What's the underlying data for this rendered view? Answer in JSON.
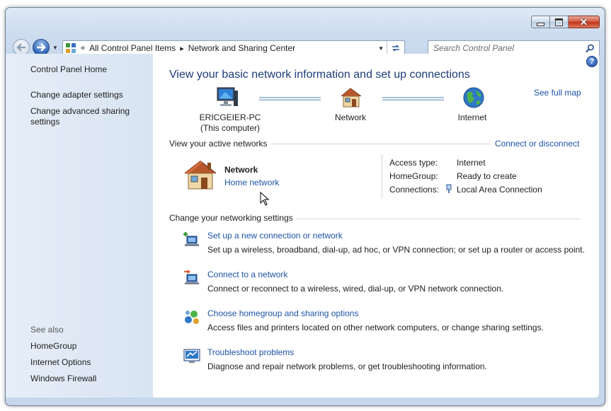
{
  "address_bar": {
    "prefix": "«",
    "crumbs": [
      "All Control Panel Items",
      "Network and Sharing Center"
    ],
    "separator": "▸"
  },
  "search": {
    "placeholder": "Search Control Panel"
  },
  "caption_buttons": {
    "minimize": "–",
    "maximize": "□",
    "close": "✕"
  },
  "sidebar": {
    "home": "Control Panel Home",
    "links": [
      "Change adapter settings",
      "Change advanced sharing settings"
    ],
    "see_also_heading": "See also",
    "see_also": [
      "HomeGroup",
      "Internet Options",
      "Windows Firewall"
    ]
  },
  "main": {
    "title": "View your basic network information and set up connections",
    "see_full_map": "See full map",
    "map": {
      "computer_name": "ERICGEIER-PC",
      "computer_sub": "(This computer)",
      "network": "Network",
      "internet": "Internet"
    },
    "active_networks": {
      "heading": "View your active networks",
      "connect_link": "Connect or disconnect",
      "network_name": "Network",
      "network_type": "Home network",
      "access_type_label": "Access type:",
      "access_type_value": "Internet",
      "homegroup_label": "HomeGroup:",
      "homegroup_value": "Ready to create",
      "connections_label": "Connections:",
      "connections_value": "Local Area Connection"
    },
    "networking_settings": {
      "heading": "Change your networking settings",
      "tasks": [
        {
          "title": "Set up a new connection or network",
          "desc": "Set up a wireless, broadband, dial-up, ad hoc, or VPN connection; or set up a router or access point."
        },
        {
          "title": "Connect to a network",
          "desc": "Connect or reconnect to a wireless, wired, dial-up, or VPN network connection."
        },
        {
          "title": "Choose homegroup and sharing options",
          "desc": "Access files and printers located on other network computers, or change sharing settings."
        },
        {
          "title": "Troubleshoot problems",
          "desc": "Diagnose and repair network problems, or get troubleshooting information."
        }
      ]
    }
  },
  "colors": {
    "link": "#1c54a8",
    "title": "#1d3c7a",
    "sidebar": "#dfe8f4"
  }
}
